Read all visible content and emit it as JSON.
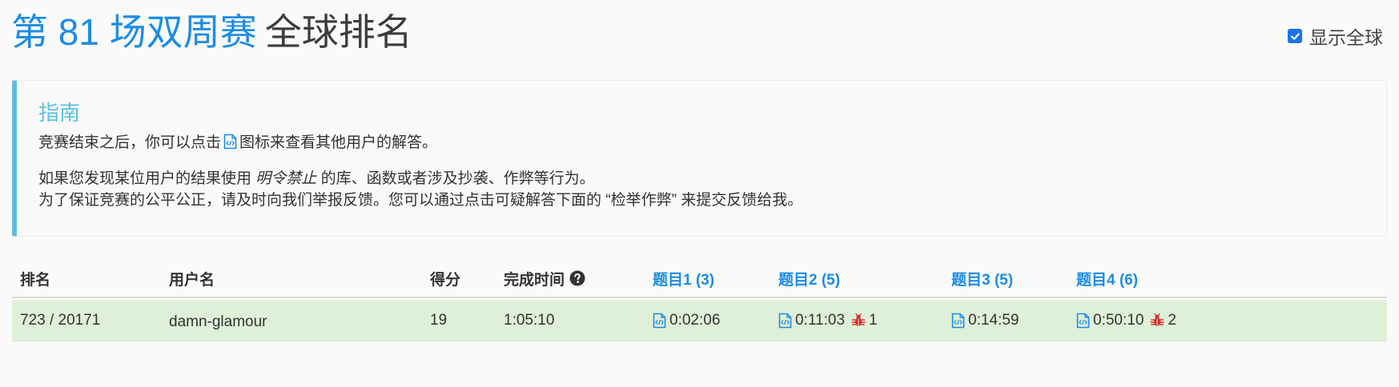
{
  "header": {
    "contest_name": "第 81 场双周赛",
    "page_subtitle": "全球排名",
    "show_global_label": "显示全球",
    "show_global_checked": true
  },
  "guide": {
    "title": "指南",
    "line1_before": "竞赛结束之后，你可以点击",
    "line1_after": "图标来查看其他用户的解答。",
    "line2_before": "如果您发现某位用户的结果使用",
    "line2_em": "明令禁止",
    "line2_after": "的库、函数或者涉及抄袭、作弊等行为。",
    "line3": "为了保证竞赛的公平公正，请及时向我们举报反馈。您可以通过点击可疑解答下面的 “检举作弊” 来提交反馈给我。"
  },
  "table": {
    "headers": {
      "rank": "排名",
      "username": "用户名",
      "score": "得分",
      "finish_time": "完成时间",
      "q1": "题目1 (3)",
      "q2": "题目2 (5)",
      "q3": "题目3 (5)",
      "q4": "题目4 (6)"
    },
    "row": {
      "rank": "723 / 20171",
      "username": "damn-glamour",
      "score": "19",
      "finish_time": "1:05:10",
      "q1_time": "0:02:06",
      "q2_time": "0:11:03",
      "q2_wrong": "1",
      "q3_time": "0:14:59",
      "q4_time": "0:50:10",
      "q4_wrong": "2"
    }
  },
  "icons": {
    "code": "code-file-icon",
    "help": "question-circle-icon",
    "bug": "bug-icon",
    "check": "check-icon"
  },
  "colors": {
    "accent": "#1c8ce6",
    "guide_accent": "#5bc0de",
    "row_success": "#dff0d8",
    "bug": "#d9302c"
  }
}
